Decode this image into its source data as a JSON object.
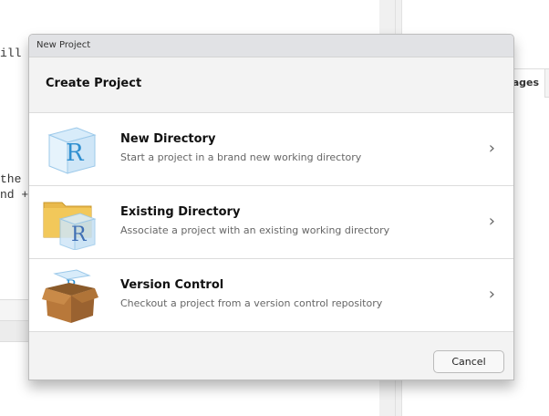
{
  "background": {
    "code_lines": [
      "ill",
      "the",
      "nd +"
    ],
    "right_tab_label": "ages"
  },
  "dialog": {
    "window_title": "New Project",
    "heading": "Create Project",
    "options": [
      {
        "title": "New Directory",
        "description": "Start a project in a brand new working directory",
        "icon": "r-cube-icon"
      },
      {
        "title": "Existing Directory",
        "description": "Associate a project with an existing working directory",
        "icon": "folder-r-icon"
      },
      {
        "title": "Version Control",
        "description": "Checkout a project from a version control repository",
        "icon": "box-icon"
      }
    ],
    "cancel_label": "Cancel"
  }
}
